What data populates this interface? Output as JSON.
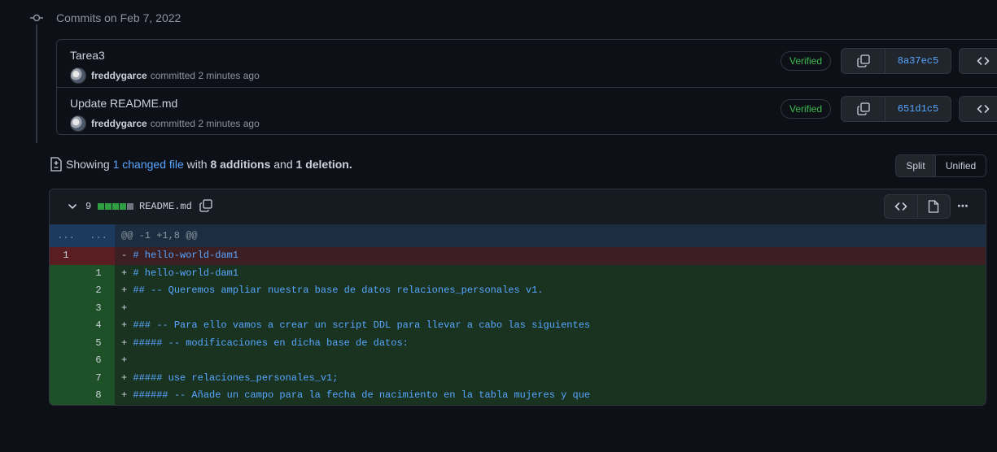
{
  "commits_header": {
    "date_label": "Commits on Feb 7, 2022"
  },
  "commits": [
    {
      "title": "Tarea3",
      "author": "freddygarce",
      "action": "committed 2 minutes ago",
      "verified": "Verified",
      "sha": "8a37ec5"
    },
    {
      "title": "Update README.md",
      "author": "freddygarce",
      "action": "committed 2 minutes ago",
      "verified": "Verified",
      "sha": "651d1c5"
    }
  ],
  "summary": {
    "showing": "Showing",
    "changed": "1 changed file",
    "with": "with",
    "additions": "8 additions",
    "and": "and",
    "deletions": "1 deletion",
    "period": "."
  },
  "view_toggle": {
    "split": "Split",
    "unified": "Unified"
  },
  "file": {
    "change_count": "9",
    "name": "README.md",
    "diffstat": [
      "add",
      "add",
      "add",
      "add",
      "del"
    ],
    "hunk_old": "...",
    "hunk_new": "...",
    "hunk_header": "@@ -1 +1,8 @@",
    "lines": [
      {
        "type": "del",
        "old": "1",
        "new": "",
        "marker": "-",
        "text": "# hello-world-dam1"
      },
      {
        "type": "add",
        "old": "",
        "new": "1",
        "marker": "+",
        "text": "# hello-world-dam1"
      },
      {
        "type": "add",
        "old": "",
        "new": "2",
        "marker": "+",
        "text": "## -- Queremos ampliar nuestra base de datos relaciones_personales v1."
      },
      {
        "type": "add",
        "old": "",
        "new": "3",
        "marker": "+",
        "text": ""
      },
      {
        "type": "add",
        "old": "",
        "new": "4",
        "marker": "+",
        "text": "### -- Para ello vamos a crear un script DDL para llevar a cabo las siguientes"
      },
      {
        "type": "add",
        "old": "",
        "new": "5",
        "marker": "+",
        "text": "##### -- modificaciones en dicha base de datos:"
      },
      {
        "type": "add",
        "old": "",
        "new": "6",
        "marker": "+",
        "text": ""
      },
      {
        "type": "add",
        "old": "",
        "new": "7",
        "marker": "+",
        "text": "##### use relaciones_personales_v1;"
      },
      {
        "type": "add",
        "old": "",
        "new": "8",
        "marker": "+",
        "text": "###### -- Añade un campo para la fecha de nacimiento en la tabla mujeres y que"
      }
    ]
  },
  "colors": {
    "background": "#0d1117",
    "link": "#58a6ff",
    "verified": "#3fb950",
    "addition": "#2ea043"
  }
}
